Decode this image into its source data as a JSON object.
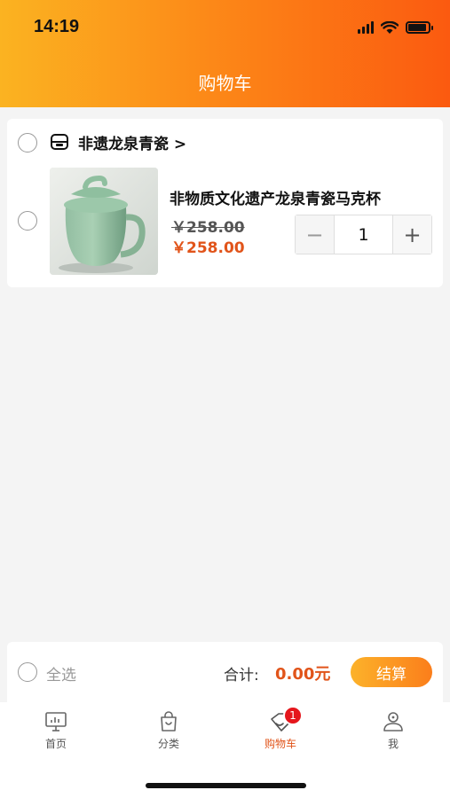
{
  "status_bar": {
    "time": "14:19",
    "battery_level": 0.9
  },
  "header": {
    "title": "购物车"
  },
  "store": {
    "name": "非遗龙泉青瓷 >",
    "items": [
      {
        "title": "非物质文化遗产龙泉青瓷马克杯",
        "original_price": "￥258.00",
        "price": "￥258.00",
        "quantity": "1"
      }
    ]
  },
  "stepper": {
    "minus": "−",
    "plus": "+"
  },
  "checkout": {
    "select_all": "全选",
    "total_label": "合计:",
    "total_value": "0.00元",
    "button": "结算"
  },
  "tabbar": {
    "tabs": [
      {
        "label": "首页",
        "icon": "monitor-icon"
      },
      {
        "label": "分类",
        "icon": "shopping-bag-icon"
      },
      {
        "label": "购物车",
        "icon": "tag-icon",
        "badge": "1"
      },
      {
        "label": "我",
        "icon": "user-icon"
      }
    ]
  },
  "colors": {
    "accent": "#e1541a",
    "header_start": "#fbb321",
    "header_end": "#fb5a10",
    "badge": "#e5161c"
  }
}
